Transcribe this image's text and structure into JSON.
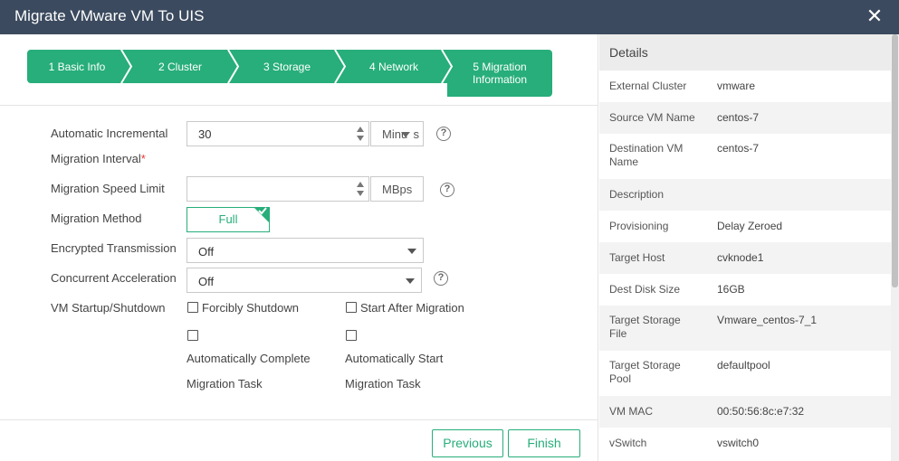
{
  "window": {
    "title": "Migrate VMware VM To UIS",
    "close_icon": "close-icon"
  },
  "steps": [
    {
      "label": "1 Basic Info"
    },
    {
      "label": "2 Cluster"
    },
    {
      "label": "3 Storage"
    },
    {
      "label": "4 Network"
    },
    {
      "label_line1": "5 Migration",
      "label_line2": "Information"
    }
  ],
  "form": {
    "interval": {
      "label_line1": "Automatic Incremental",
      "label_line2": "Migration Interval",
      "required_mark": "*",
      "value": "30",
      "unit": "Minu",
      "unit_tail": "s"
    },
    "speed": {
      "label": "Migration Speed Limit",
      "value": "",
      "unit": "MBps"
    },
    "method": {
      "label": "Migration Method",
      "value": "Full"
    },
    "encrypted": {
      "label": "Encrypted Transmission",
      "value": "Off"
    },
    "concurrent": {
      "label": "Concurrent Acceleration",
      "value": "Off"
    },
    "startup": {
      "label": "VM Startup/Shutdown",
      "forcibly_shutdown": "Forcibly Shutdown",
      "start_after": "Start After Migration",
      "auto_complete_1": "Automatically Complete",
      "auto_complete_2": "Migration Task",
      "auto_start_1": "Automatically Start",
      "auto_start_2": "Migration Task"
    },
    "help_glyph": "?"
  },
  "buttons": {
    "previous": "Previous",
    "finish": "Finish"
  },
  "details": {
    "title": "Details",
    "rows": [
      {
        "key": "External Cluster",
        "value": "vmware"
      },
      {
        "key": "Source VM Name",
        "value": "centos-7"
      },
      {
        "key": "Destination VM Name",
        "value": "centos-7"
      },
      {
        "key": "Description",
        "value": ""
      },
      {
        "key": "Provisioning",
        "value": "Delay Zeroed"
      },
      {
        "key": "Target Host",
        "value": "cvknode1"
      },
      {
        "key": "Dest Disk Size",
        "value": "16GB"
      },
      {
        "key": "Target Storage File",
        "value": "Vmware_centos-7_1"
      },
      {
        "key": "Target Storage Pool",
        "value": "defaultpool"
      },
      {
        "key": "VM MAC",
        "value": "00:50:56:8c:e7:32"
      },
      {
        "key": "vSwitch",
        "value": "vswitch0"
      }
    ]
  },
  "colors": {
    "accent": "#27ae7a",
    "titlebar": "#3b4a5e",
    "required": "#e53935"
  }
}
